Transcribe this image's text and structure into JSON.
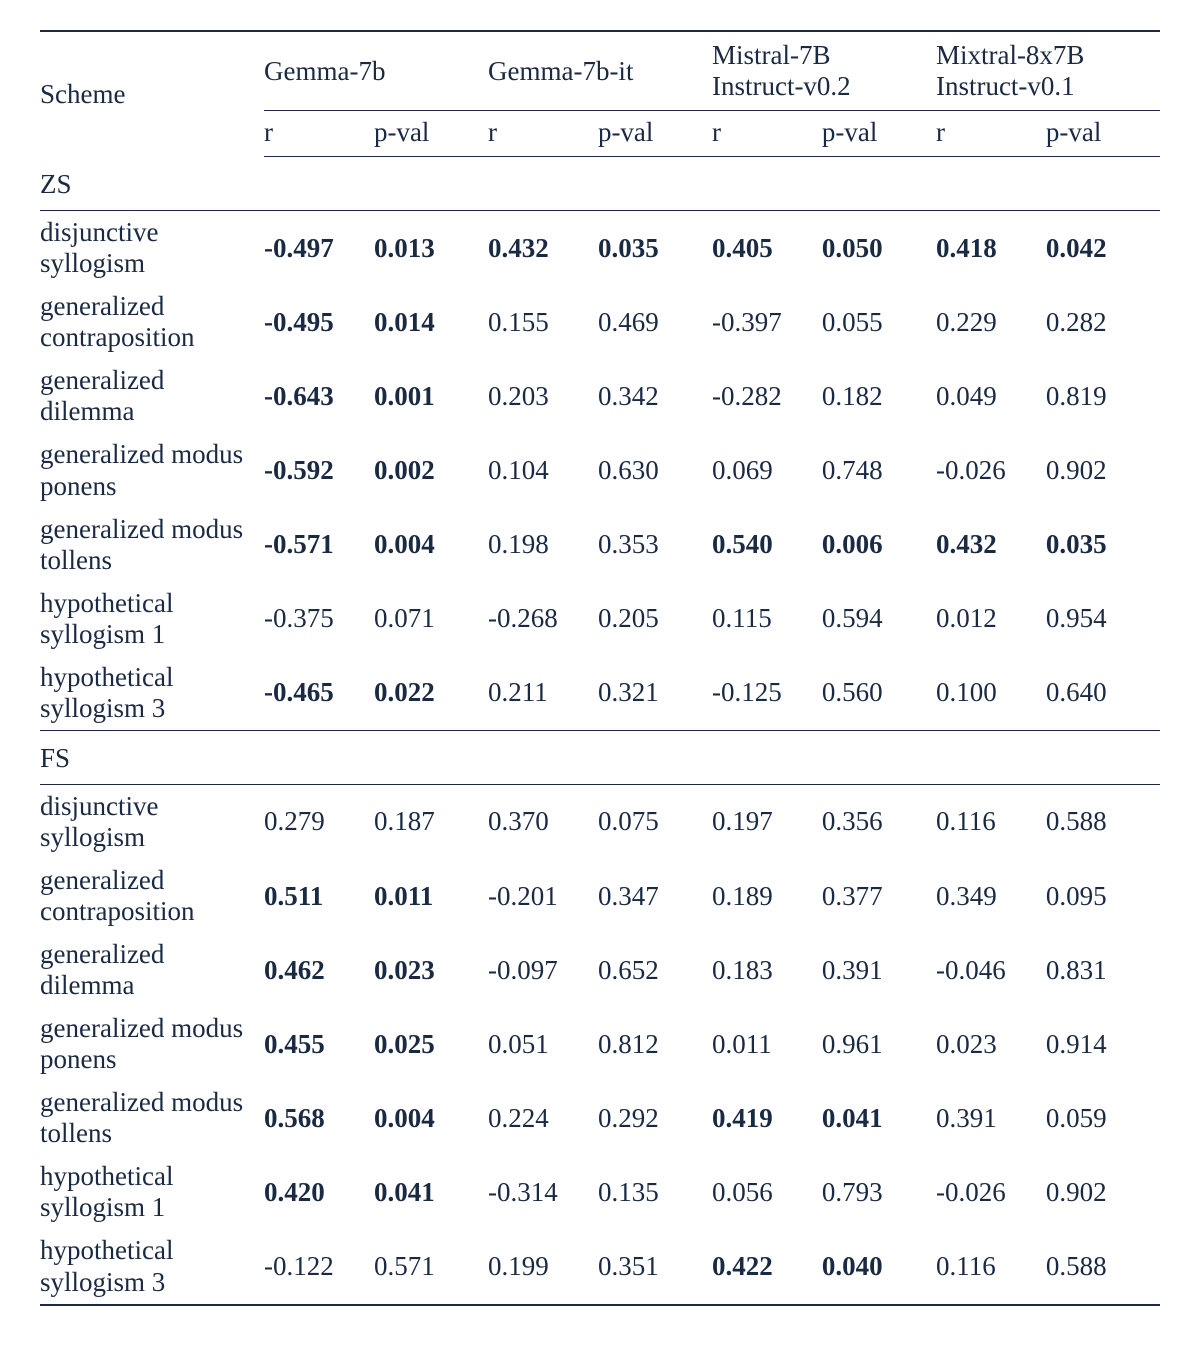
{
  "headers": {
    "scheme": "Scheme",
    "models": [
      {
        "name_line1": "Gemma-7b",
        "name_line2": ""
      },
      {
        "name_line1": "Gemma-7b-it",
        "name_line2": ""
      },
      {
        "name_line1": "Mistral-7B",
        "name_line2": "Instruct-v0.2"
      },
      {
        "name_line1": "Mixtral-8x7B",
        "name_line2": "Instruct-v0.1"
      }
    ],
    "sub": {
      "r": "r",
      "p": "p-val"
    }
  },
  "sections": [
    {
      "label": "ZS",
      "rows": [
        {
          "scheme": "disjunctive syllogism",
          "cells": [
            {
              "v": "-0.497",
              "b": true
            },
            {
              "v": "0.013",
              "b": true
            },
            {
              "v": "0.432",
              "b": true
            },
            {
              "v": "0.035",
              "b": true
            },
            {
              "v": "0.405",
              "b": true
            },
            {
              "v": "0.050",
              "b": true
            },
            {
              "v": "0.418",
              "b": true
            },
            {
              "v": "0.042",
              "b": true
            }
          ]
        },
        {
          "scheme": "generalized contraposition",
          "cells": [
            {
              "v": "-0.495",
              "b": true
            },
            {
              "v": "0.014",
              "b": true
            },
            {
              "v": "0.155",
              "b": false
            },
            {
              "v": "0.469",
              "b": false
            },
            {
              "v": "-0.397",
              "b": false
            },
            {
              "v": "0.055",
              "b": false
            },
            {
              "v": "0.229",
              "b": false
            },
            {
              "v": "0.282",
              "b": false
            }
          ]
        },
        {
          "scheme": "generalized dilemma",
          "cells": [
            {
              "v": "-0.643",
              "b": true
            },
            {
              "v": "0.001",
              "b": true
            },
            {
              "v": "0.203",
              "b": false
            },
            {
              "v": "0.342",
              "b": false
            },
            {
              "v": "-0.282",
              "b": false
            },
            {
              "v": "0.182",
              "b": false
            },
            {
              "v": "0.049",
              "b": false
            },
            {
              "v": "0.819",
              "b": false
            }
          ]
        },
        {
          "scheme": "generalized modus ponens",
          "cells": [
            {
              "v": "-0.592",
              "b": true
            },
            {
              "v": "0.002",
              "b": true
            },
            {
              "v": "0.104",
              "b": false
            },
            {
              "v": "0.630",
              "b": false
            },
            {
              "v": "0.069",
              "b": false
            },
            {
              "v": "0.748",
              "b": false
            },
            {
              "v": "-0.026",
              "b": false
            },
            {
              "v": "0.902",
              "b": false
            }
          ]
        },
        {
          "scheme": "generalized modus tollens",
          "cells": [
            {
              "v": "-0.571",
              "b": true
            },
            {
              "v": "0.004",
              "b": true
            },
            {
              "v": "0.198",
              "b": false
            },
            {
              "v": "0.353",
              "b": false
            },
            {
              "v": "0.540",
              "b": true
            },
            {
              "v": "0.006",
              "b": true
            },
            {
              "v": "0.432",
              "b": true
            },
            {
              "v": "0.035",
              "b": true
            }
          ]
        },
        {
          "scheme": "hypothetical syllogism 1",
          "cells": [
            {
              "v": "-0.375",
              "b": false
            },
            {
              "v": "0.071",
              "b": false
            },
            {
              "v": "-0.268",
              "b": false
            },
            {
              "v": "0.205",
              "b": false
            },
            {
              "v": "0.115",
              "b": false
            },
            {
              "v": "0.594",
              "b": false
            },
            {
              "v": "0.012",
              "b": false
            },
            {
              "v": "0.954",
              "b": false
            }
          ]
        },
        {
          "scheme": "hypothetical syllogism 3",
          "cells": [
            {
              "v": "-0.465",
              "b": true
            },
            {
              "v": "0.022",
              "b": true
            },
            {
              "v": "0.211",
              "b": false
            },
            {
              "v": "0.321",
              "b": false
            },
            {
              "v": "-0.125",
              "b": false
            },
            {
              "v": "0.560",
              "b": false
            },
            {
              "v": "0.100",
              "b": false
            },
            {
              "v": "0.640",
              "b": false
            }
          ]
        }
      ]
    },
    {
      "label": "FS",
      "rows": [
        {
          "scheme": "disjunctive syllogism",
          "cells": [
            {
              "v": "0.279",
              "b": false
            },
            {
              "v": "0.187",
              "b": false
            },
            {
              "v": "0.370",
              "b": false
            },
            {
              "v": "0.075",
              "b": false
            },
            {
              "v": "0.197",
              "b": false
            },
            {
              "v": "0.356",
              "b": false
            },
            {
              "v": "0.116",
              "b": false
            },
            {
              "v": "0.588",
              "b": false
            }
          ]
        },
        {
          "scheme": "generalized contraposition",
          "cells": [
            {
              "v": "0.511",
              "b": true
            },
            {
              "v": "0.011",
              "b": true
            },
            {
              "v": "-0.201",
              "b": false
            },
            {
              "v": "0.347",
              "b": false
            },
            {
              "v": "0.189",
              "b": false
            },
            {
              "v": "0.377",
              "b": false
            },
            {
              "v": "0.349",
              "b": false
            },
            {
              "v": "0.095",
              "b": false
            }
          ]
        },
        {
          "scheme": "generalized dilemma",
          "cells": [
            {
              "v": "0.462",
              "b": true
            },
            {
              "v": "0.023",
              "b": true
            },
            {
              "v": "-0.097",
              "b": false
            },
            {
              "v": "0.652",
              "b": false
            },
            {
              "v": "0.183",
              "b": false
            },
            {
              "v": "0.391",
              "b": false
            },
            {
              "v": "-0.046",
              "b": false
            },
            {
              "v": "0.831",
              "b": false
            }
          ]
        },
        {
          "scheme": "generalized modus ponens",
          "cells": [
            {
              "v": "0.455",
              "b": true
            },
            {
              "v": "0.025",
              "b": true
            },
            {
              "v": "0.051",
              "b": false
            },
            {
              "v": "0.812",
              "b": false
            },
            {
              "v": "0.011",
              "b": false
            },
            {
              "v": "0.961",
              "b": false
            },
            {
              "v": "0.023",
              "b": false
            },
            {
              "v": "0.914",
              "b": false
            }
          ]
        },
        {
          "scheme": "generalized modus tollens",
          "cells": [
            {
              "v": "0.568",
              "b": true
            },
            {
              "v": "0.004",
              "b": true
            },
            {
              "v": "0.224",
              "b": false
            },
            {
              "v": "0.292",
              "b": false
            },
            {
              "v": "0.419",
              "b": true
            },
            {
              "v": "0.041",
              "b": true
            },
            {
              "v": "0.391",
              "b": false
            },
            {
              "v": "0.059",
              "b": false
            }
          ]
        },
        {
          "scheme": "hypothetical syllogism 1",
          "cells": [
            {
              "v": "0.420",
              "b": true
            },
            {
              "v": "0.041",
              "b": true
            },
            {
              "v": "-0.314",
              "b": false
            },
            {
              "v": "0.135",
              "b": false
            },
            {
              "v": "0.056",
              "b": false
            },
            {
              "v": "0.793",
              "b": false
            },
            {
              "v": "-0.026",
              "b": false
            },
            {
              "v": "0.902",
              "b": false
            }
          ]
        },
        {
          "scheme": "hypothetical syllogism 3",
          "cells": [
            {
              "v": "-0.122",
              "b": false
            },
            {
              "v": "0.571",
              "b": false
            },
            {
              "v": "0.199",
              "b": false
            },
            {
              "v": "0.351",
              "b": false
            },
            {
              "v": "0.422",
              "b": true
            },
            {
              "v": "0.040",
              "b": true
            },
            {
              "v": "0.116",
              "b": false
            },
            {
              "v": "0.588",
              "b": false
            }
          ]
        }
      ]
    }
  ],
  "chart_data": {
    "type": "table",
    "title": "Correlation (r) and p-value per scheme and model, ZS vs FS",
    "models": [
      "Gemma-7b",
      "Gemma-7b-it",
      "Mistral-7B Instruct-v0.2",
      "Mixtral-8x7B Instruct-v0.1"
    ],
    "metrics": [
      "r",
      "p-val"
    ],
    "sections": {
      "ZS": [
        {
          "scheme": "disjunctive syllogism",
          "Gemma-7b": {
            "r": -0.497,
            "p": 0.013
          },
          "Gemma-7b-it": {
            "r": 0.432,
            "p": 0.035
          },
          "Mistral-7B Instruct-v0.2": {
            "r": 0.405,
            "p": 0.05
          },
          "Mixtral-8x7B Instruct-v0.1": {
            "r": 0.418,
            "p": 0.042
          }
        },
        {
          "scheme": "generalized contraposition",
          "Gemma-7b": {
            "r": -0.495,
            "p": 0.014
          },
          "Gemma-7b-it": {
            "r": 0.155,
            "p": 0.469
          },
          "Mistral-7B Instruct-v0.2": {
            "r": -0.397,
            "p": 0.055
          },
          "Mixtral-8x7B Instruct-v0.1": {
            "r": 0.229,
            "p": 0.282
          }
        },
        {
          "scheme": "generalized dilemma",
          "Gemma-7b": {
            "r": -0.643,
            "p": 0.001
          },
          "Gemma-7b-it": {
            "r": 0.203,
            "p": 0.342
          },
          "Mistral-7B Instruct-v0.2": {
            "r": -0.282,
            "p": 0.182
          },
          "Mixtral-8x7B Instruct-v0.1": {
            "r": 0.049,
            "p": 0.819
          }
        },
        {
          "scheme": "generalized modus ponens",
          "Gemma-7b": {
            "r": -0.592,
            "p": 0.002
          },
          "Gemma-7b-it": {
            "r": 0.104,
            "p": 0.63
          },
          "Mistral-7B Instruct-v0.2": {
            "r": 0.069,
            "p": 0.748
          },
          "Mixtral-8x7B Instruct-v0.1": {
            "r": -0.026,
            "p": 0.902
          }
        },
        {
          "scheme": "generalized modus tollens",
          "Gemma-7b": {
            "r": -0.571,
            "p": 0.004
          },
          "Gemma-7b-it": {
            "r": 0.198,
            "p": 0.353
          },
          "Mistral-7B Instruct-v0.2": {
            "r": 0.54,
            "p": 0.006
          },
          "Mixtral-8x7B Instruct-v0.1": {
            "r": 0.432,
            "p": 0.035
          }
        },
        {
          "scheme": "hypothetical syllogism 1",
          "Gemma-7b": {
            "r": -0.375,
            "p": 0.071
          },
          "Gemma-7b-it": {
            "r": -0.268,
            "p": 0.205
          },
          "Mistral-7B Instruct-v0.2": {
            "r": 0.115,
            "p": 0.594
          },
          "Mixtral-8x7B Instruct-v0.1": {
            "r": 0.012,
            "p": 0.954
          }
        },
        {
          "scheme": "hypothetical syllogism 3",
          "Gemma-7b": {
            "r": -0.465,
            "p": 0.022
          },
          "Gemma-7b-it": {
            "r": 0.211,
            "p": 0.321
          },
          "Mistral-7B Instruct-v0.2": {
            "r": -0.125,
            "p": 0.56
          },
          "Mixtral-8x7B Instruct-v0.1": {
            "r": 0.1,
            "p": 0.64
          }
        }
      ],
      "FS": [
        {
          "scheme": "disjunctive syllogism",
          "Gemma-7b": {
            "r": 0.279,
            "p": 0.187
          },
          "Gemma-7b-it": {
            "r": 0.37,
            "p": 0.075
          },
          "Mistral-7B Instruct-v0.2": {
            "r": 0.197,
            "p": 0.356
          },
          "Mixtral-8x7B Instruct-v0.1": {
            "r": 0.116,
            "p": 0.588
          }
        },
        {
          "scheme": "generalized contraposition",
          "Gemma-7b": {
            "r": 0.511,
            "p": 0.011
          },
          "Gemma-7b-it": {
            "r": -0.201,
            "p": 0.347
          },
          "Mistral-7B Instruct-v0.2": {
            "r": 0.189,
            "p": 0.377
          },
          "Mixtral-8x7B Instruct-v0.1": {
            "r": 0.349,
            "p": 0.095
          }
        },
        {
          "scheme": "generalized dilemma",
          "Gemma-7b": {
            "r": 0.462,
            "p": 0.023
          },
          "Gemma-7b-it": {
            "r": -0.097,
            "p": 0.652
          },
          "Mistral-7B Instruct-v0.2": {
            "r": 0.183,
            "p": 0.391
          },
          "Mixtral-8x7B Instruct-v0.1": {
            "r": -0.046,
            "p": 0.831
          }
        },
        {
          "scheme": "generalized modus ponens",
          "Gemma-7b": {
            "r": 0.455,
            "p": 0.025
          },
          "Gemma-7b-it": {
            "r": 0.051,
            "p": 0.812
          },
          "Mistral-7B Instruct-v0.2": {
            "r": 0.011,
            "p": 0.961
          },
          "Mixtral-8x7B Instruct-v0.1": {
            "r": 0.023,
            "p": 0.914
          }
        },
        {
          "scheme": "generalized modus tollens",
          "Gemma-7b": {
            "r": 0.568,
            "p": 0.004
          },
          "Gemma-7b-it": {
            "r": 0.224,
            "p": 0.292
          },
          "Mistral-7B Instruct-v0.2": {
            "r": 0.419,
            "p": 0.041
          },
          "Mixtral-8x7B Instruct-v0.1": {
            "r": 0.391,
            "p": 0.059
          }
        },
        {
          "scheme": "hypothetical syllogism 1",
          "Gemma-7b": {
            "r": 0.42,
            "p": 0.041
          },
          "Gemma-7b-it": {
            "r": -0.314,
            "p": 0.135
          },
          "Mistral-7B Instruct-v0.2": {
            "r": 0.056,
            "p": 0.793
          },
          "Mixtral-8x7B Instruct-v0.1": {
            "r": -0.026,
            "p": 0.902
          }
        },
        {
          "scheme": "hypothetical syllogism 3",
          "Gemma-7b": {
            "r": -0.122,
            "p": 0.571
          },
          "Gemma-7b-it": {
            "r": 0.199,
            "p": 0.351
          },
          "Mistral-7B Instruct-v0.2": {
            "r": 0.422,
            "p": 0.04
          },
          "Mixtral-8x7B Instruct-v0.1": {
            "r": 0.116,
            "p": 0.588
          }
        }
      ]
    }
  }
}
